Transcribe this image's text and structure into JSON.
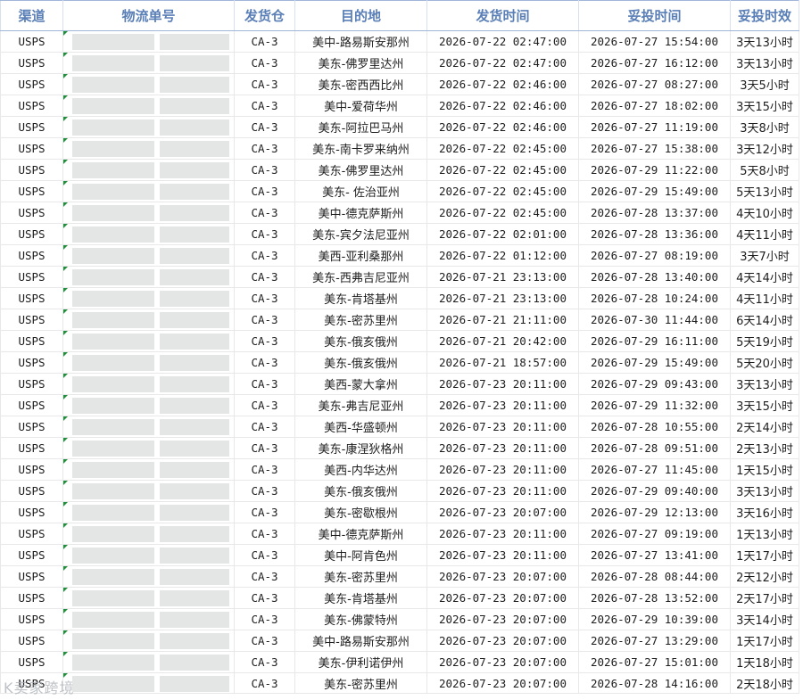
{
  "headers": {
    "channel": "渠道",
    "tracking_no": "物流单号",
    "warehouse": "发货仓",
    "destination": "目的地",
    "ship_time": "发货时间",
    "deliver_time": "妥投时间",
    "duration": "妥投时效"
  },
  "rows": [
    {
      "channel": "USPS",
      "warehouse": "CA-3",
      "destination": "美中-路易斯安那州",
      "ship_time": "2026-07-22 02:47:00",
      "deliver_time": "2026-07-27 15:54:00",
      "duration": "3天13小时"
    },
    {
      "channel": "USPS",
      "warehouse": "CA-3",
      "destination": "美东-佛罗里达州",
      "ship_time": "2026-07-22 02:47:00",
      "deliver_time": "2026-07-27 16:12:00",
      "duration": "3天13小时"
    },
    {
      "channel": "USPS",
      "warehouse": "CA-3",
      "destination": "美东-密西西比州",
      "ship_time": "2026-07-22 02:46:00",
      "deliver_time": "2026-07-27 08:27:00",
      "duration": "3天5小时"
    },
    {
      "channel": "USPS",
      "warehouse": "CA-3",
      "destination": "美中-爱荷华州",
      "ship_time": "2026-07-22 02:46:00",
      "deliver_time": "2026-07-27 18:02:00",
      "duration": "3天15小时"
    },
    {
      "channel": "USPS",
      "warehouse": "CA-3",
      "destination": "美东-阿拉巴马州",
      "ship_time": "2026-07-22 02:46:00",
      "deliver_time": "2026-07-27 11:19:00",
      "duration": "3天8小时"
    },
    {
      "channel": "USPS",
      "warehouse": "CA-3",
      "destination": "美东-南卡罗来纳州",
      "ship_time": "2026-07-22 02:45:00",
      "deliver_time": "2026-07-27 15:38:00",
      "duration": "3天12小时"
    },
    {
      "channel": "USPS",
      "warehouse": "CA-3",
      "destination": "美东-佛罗里达州",
      "ship_time": "2026-07-22 02:45:00",
      "deliver_time": "2026-07-29 11:22:00",
      "duration": "5天8小时"
    },
    {
      "channel": "USPS",
      "warehouse": "CA-3",
      "destination": "美东- 佐治亚州",
      "ship_time": "2026-07-22 02:45:00",
      "deliver_time": "2026-07-29 15:49:00",
      "duration": "5天13小时"
    },
    {
      "channel": "USPS",
      "warehouse": "CA-3",
      "destination": "美中-德克萨斯州",
      "ship_time": "2026-07-22 02:45:00",
      "deliver_time": "2026-07-28 13:37:00",
      "duration": "4天10小时"
    },
    {
      "channel": "USPS",
      "warehouse": "CA-3",
      "destination": "美东-宾夕法尼亚州",
      "ship_time": "2026-07-22 02:01:00",
      "deliver_time": "2026-07-28 13:36:00",
      "duration": "4天11小时"
    },
    {
      "channel": "USPS",
      "warehouse": "CA-3",
      "destination": "美西-亚利桑那州",
      "ship_time": "2026-07-22 01:12:00",
      "deliver_time": "2026-07-27 08:19:00",
      "duration": "3天7小时"
    },
    {
      "channel": "USPS",
      "warehouse": "CA-3",
      "destination": "美东-西弗吉尼亚州",
      "ship_time": "2026-07-21 23:13:00",
      "deliver_time": "2026-07-28 13:40:00",
      "duration": "4天14小时"
    },
    {
      "channel": "USPS",
      "warehouse": "CA-3",
      "destination": "美东-肯塔基州",
      "ship_time": "2026-07-21 23:13:00",
      "deliver_time": "2026-07-28 10:24:00",
      "duration": "4天11小时"
    },
    {
      "channel": "USPS",
      "warehouse": "CA-3",
      "destination": "美东-密苏里州",
      "ship_time": "2026-07-21 21:11:00",
      "deliver_time": "2026-07-30 11:44:00",
      "duration": "6天14小时"
    },
    {
      "channel": "USPS",
      "warehouse": "CA-3",
      "destination": "美东-俄亥俄州",
      "ship_time": "2026-07-21 20:42:00",
      "deliver_time": "2026-07-29 16:11:00",
      "duration": "5天19小时"
    },
    {
      "channel": "USPS",
      "warehouse": "CA-3",
      "destination": "美东-俄亥俄州",
      "ship_time": "2026-07-21 18:57:00",
      "deliver_time": "2026-07-29 15:49:00",
      "duration": "5天20小时"
    },
    {
      "channel": "USPS",
      "warehouse": "CA-3",
      "destination": "美西-蒙大拿州",
      "ship_time": "2026-07-23 20:11:00",
      "deliver_time": "2026-07-29 09:43:00",
      "duration": "3天13小时"
    },
    {
      "channel": "USPS",
      "warehouse": "CA-3",
      "destination": "美东-弗吉尼亚州",
      "ship_time": "2026-07-23 20:11:00",
      "deliver_time": "2026-07-29 11:32:00",
      "duration": "3天15小时"
    },
    {
      "channel": "USPS",
      "warehouse": "CA-3",
      "destination": "美西-华盛顿州",
      "ship_time": "2026-07-23 20:11:00",
      "deliver_time": "2026-07-28 10:55:00",
      "duration": "2天14小时"
    },
    {
      "channel": "USPS",
      "warehouse": "CA-3",
      "destination": "美东-康涅狄格州",
      "ship_time": "2026-07-23 20:11:00",
      "deliver_time": "2026-07-28 09:51:00",
      "duration": "2天13小时"
    },
    {
      "channel": "USPS",
      "warehouse": "CA-3",
      "destination": "美西-内华达州",
      "ship_time": "2026-07-23 20:11:00",
      "deliver_time": "2026-07-27 11:45:00",
      "duration": "1天15小时"
    },
    {
      "channel": "USPS",
      "warehouse": "CA-3",
      "destination": "美东-俄亥俄州",
      "ship_time": "2026-07-23 20:11:00",
      "deliver_time": "2026-07-29 09:40:00",
      "duration": "3天13小时"
    },
    {
      "channel": "USPS",
      "warehouse": "CA-3",
      "destination": "美东-密歇根州",
      "ship_time": "2026-07-23 20:07:00",
      "deliver_time": "2026-07-29 12:13:00",
      "duration": "3天16小时"
    },
    {
      "channel": "USPS",
      "warehouse": "CA-3",
      "destination": "美中-德克萨斯州",
      "ship_time": "2026-07-23 20:11:00",
      "deliver_time": "2026-07-27 09:19:00",
      "duration": "1天13小时"
    },
    {
      "channel": "USPS",
      "warehouse": "CA-3",
      "destination": "美中-阿肯色州",
      "ship_time": "2026-07-23 20:11:00",
      "deliver_time": "2026-07-27 13:41:00",
      "duration": "1天17小时"
    },
    {
      "channel": "USPS",
      "warehouse": "CA-3",
      "destination": "美东-密苏里州",
      "ship_time": "2026-07-23 20:07:00",
      "deliver_time": "2026-07-28 08:44:00",
      "duration": "2天12小时"
    },
    {
      "channel": "USPS",
      "warehouse": "CA-3",
      "destination": "美东-肯塔基州",
      "ship_time": "2026-07-23 20:07:00",
      "deliver_time": "2026-07-28 13:52:00",
      "duration": "2天17小时"
    },
    {
      "channel": "USPS",
      "warehouse": "CA-3",
      "destination": "美东-佛蒙特州",
      "ship_time": "2026-07-23 20:07:00",
      "deliver_time": "2026-07-29 10:39:00",
      "duration": "3天14小时"
    },
    {
      "channel": "USPS",
      "warehouse": "CA-3",
      "destination": "美中-路易斯安那州",
      "ship_time": "2026-07-23 20:07:00",
      "deliver_time": "2026-07-27 13:29:00",
      "duration": "1天17小时"
    },
    {
      "channel": "USPS",
      "warehouse": "CA-3",
      "destination": "美东-伊利诺伊州",
      "ship_time": "2026-07-23 20:07:00",
      "deliver_time": "2026-07-27 15:01:00",
      "duration": "1天18小时"
    },
    {
      "channel": "USPS",
      "warehouse": "CA-3",
      "destination": "美东-密苏里州",
      "ship_time": "2026-07-23 20:07:00",
      "deliver_time": "2026-07-28 14:16:00",
      "duration": "2天18小时"
    }
  ],
  "watermark": "K卖家跨境",
  "colors": {
    "header_text": "#5a7fb6",
    "header_border": "#9fb6d8",
    "comment_marker": "#1e8f3b",
    "redacted": "#e3e6e4"
  }
}
